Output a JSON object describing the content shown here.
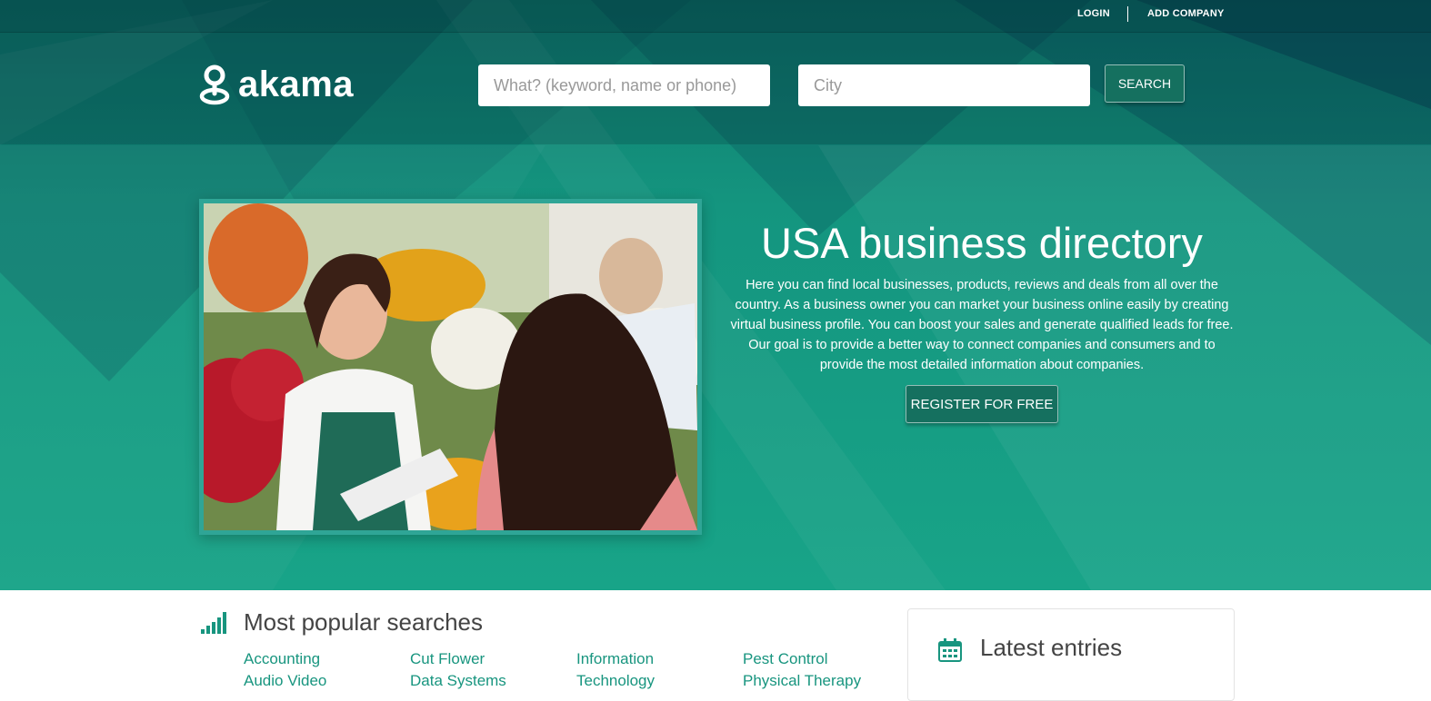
{
  "topbar": {
    "login": "LOGIN",
    "add_company": "ADD COMPANY"
  },
  "brand": {
    "name": "akama"
  },
  "search": {
    "what_placeholder": "What? (keyword, name or phone)",
    "city_placeholder": "City",
    "button_label": "SEARCH"
  },
  "hero": {
    "title": "USA business directory",
    "description": "Here you can find local businesses, products, reviews and deals from all over the country. As a business owner you can market your business online easily by creating virtual business profile. You can boost your sales and generate qualified leads for free. Our goal is to provide a better way to connect companies and consumers and to provide the most detailed information about companies.",
    "register_label": "REGISTER FOR FREE"
  },
  "popular": {
    "title": "Most popular searches",
    "items": [
      "Accounting",
      "Cut Flower",
      "Information",
      "Pest Control",
      "Audio Video",
      "Data Systems",
      "Technology",
      "Physical Therapy"
    ]
  },
  "latest": {
    "title": "Latest entries"
  },
  "colors": {
    "accent": "#18a488",
    "button": "#15705f",
    "link": "#18957f"
  }
}
